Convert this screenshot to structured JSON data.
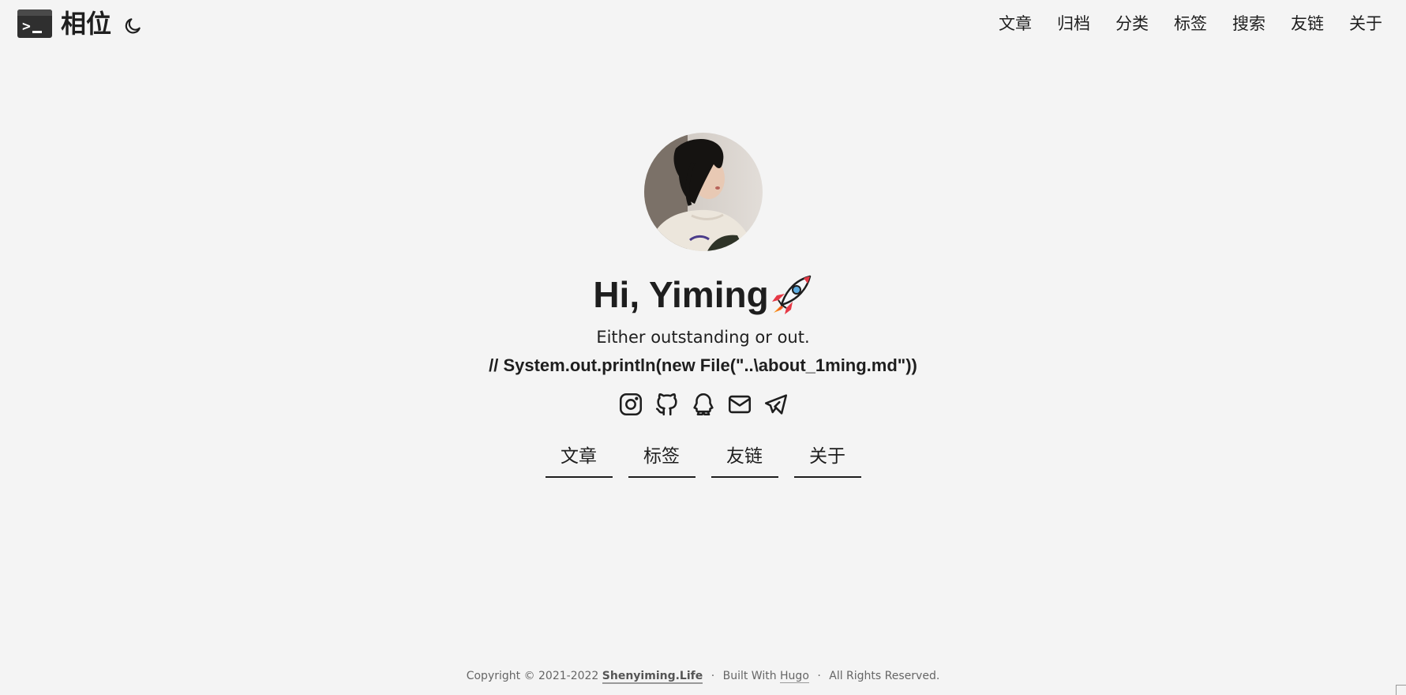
{
  "header": {
    "site_title": "相位",
    "nav": [
      "文章",
      "归档",
      "分类",
      "标签",
      "搜索",
      "友链",
      "关于"
    ]
  },
  "profile": {
    "greeting": "Hi, Yiming",
    "subtitle": "Either outstanding or out.",
    "code_line": "// System.out.println(new File(\"..\\about_1ming.md\"))",
    "socials": [
      "instagram-icon",
      "github-icon",
      "qq-icon",
      "email-icon",
      "telegram-icon"
    ]
  },
  "home_buttons": [
    "文章",
    "标签",
    "友链",
    "关于"
  ],
  "footer": {
    "copyright": "Copyright © 2021-2022",
    "site_link": "Shenyiming.Life",
    "separator": "·",
    "built_with": "Built With",
    "hugo": "Hugo",
    "rights": "All Rights Reserved."
  }
}
